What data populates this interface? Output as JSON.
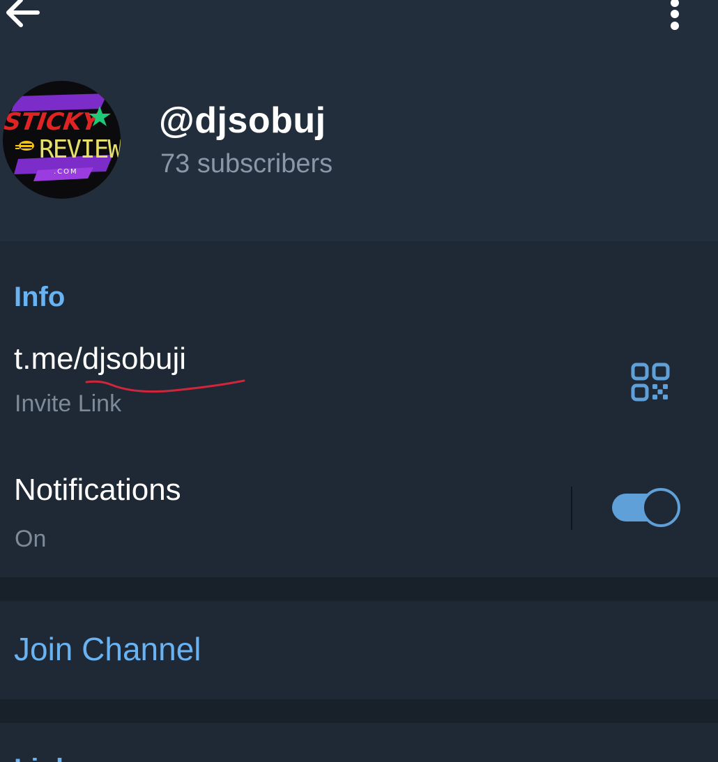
{
  "header": {
    "back_icon": "arrow-left-icon",
    "more_icon": "more-vertical-icon",
    "channel_name": "@djsobuj",
    "subscribers": "73 subscribers",
    "avatar": {
      "logo_top": "STICKY",
      "logo_main": "REVIEW",
      "logo_sub": ".COM"
    }
  },
  "info": {
    "title": "Info",
    "link_value": "t.me/djsobuji",
    "link_label": "Invite Link",
    "qr_icon": "qr-code-icon",
    "notifications_title": "Notifications",
    "notifications_status": "On",
    "notifications_enabled": true
  },
  "join": {
    "label": "Join Channel"
  },
  "links": {
    "title": "Links"
  },
  "colors": {
    "accent": "#6ab3f3",
    "toggle": "#5fa0d9",
    "header_bg": "#232e3c",
    "section_bg": "#1f2835",
    "gap_bg": "#18202a",
    "secondary_text": "#8a97a6",
    "scribble": "#d0263b"
  }
}
